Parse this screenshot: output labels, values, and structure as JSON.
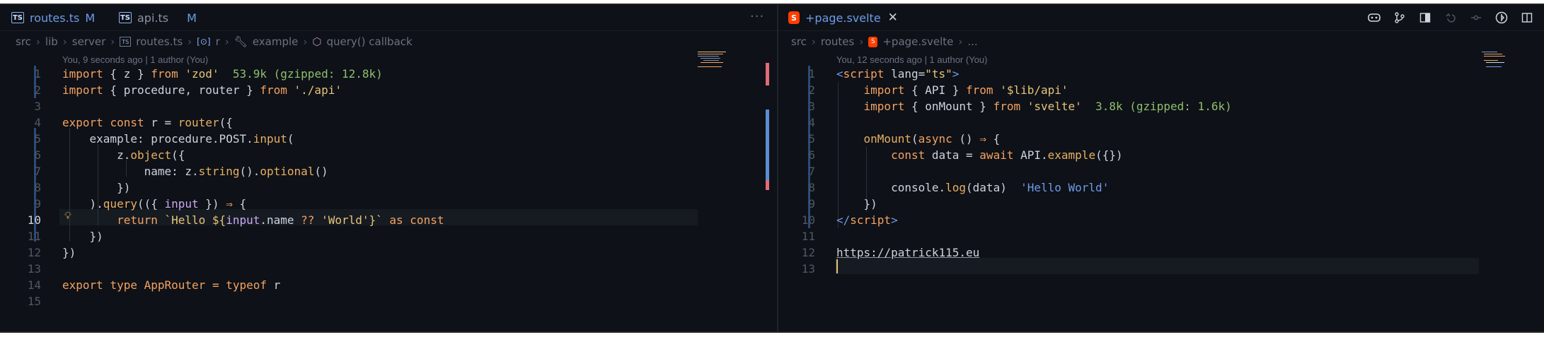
{
  "left": {
    "tabs": [
      {
        "label": "routes.ts",
        "modified": "M",
        "logo": "TS"
      },
      {
        "label": "api.ts",
        "modified": "M",
        "logo": "TS"
      }
    ],
    "ellipsis": "···",
    "breadcrumb": [
      "src",
      "lib",
      "server",
      "routes.ts",
      "r",
      "example",
      "query() callback"
    ],
    "breadcrumb_icons": [
      "ts-file-icon",
      "object-icon",
      "wrench-icon",
      "cube-icon"
    ],
    "codelens": "You, 9 seconds ago | 1 author (You)",
    "lines": [
      {
        "n": "1"
      },
      {
        "n": "2"
      },
      {
        "n": "3"
      },
      {
        "n": "4"
      },
      {
        "n": "5"
      },
      {
        "n": "6"
      },
      {
        "n": "7"
      },
      {
        "n": "8"
      },
      {
        "n": "9"
      },
      {
        "n": "10"
      },
      {
        "n": "11"
      },
      {
        "n": "12"
      },
      {
        "n": "13"
      },
      {
        "n": "14"
      },
      {
        "n": "15"
      }
    ],
    "code": {
      "l1": {
        "t0": "import",
        "t1": " { z } ",
        "t2": "from",
        "t3": " ",
        "t4": "'zod'",
        "t5": "  53.9k (gzipped: 12.8k)"
      },
      "l2": {
        "t0": "import",
        "t1": " { procedure, router } ",
        "t2": "from",
        "t3": " ",
        "t4": "'./api'"
      },
      "l4": {
        "t0": "export",
        "t1": " ",
        "t2": "const",
        "t3": " r = ",
        "t4": "router",
        "t5": "({"
      },
      "l5": {
        "t0": "    example: procedure.POST.",
        "t1": "input",
        "t2": "("
      },
      "l6": {
        "t0": "        z.",
        "t1": "object",
        "t2": "({"
      },
      "l7": {
        "t0": "            name: z.",
        "t1": "string",
        "t2": "().",
        "t3": "optional",
        "t4": "()"
      },
      "l8": {
        "t0": "        })"
      },
      "l9": {
        "t0": "    ).",
        "t1": "query",
        "t2": "(({ ",
        "t3": "input",
        "t4": " }) ",
        "t5": "⇒",
        "t6": " {"
      },
      "l10": {
        "t0": "        ",
        "t1": "return",
        "t2": " `Hello ${",
        "t3": "input",
        "t4": ".name ",
        "t5": "??",
        "t6": " ",
        "t7": "'World'",
        "t8": "}`",
        "t9": " as ",
        "t10": "const"
      },
      "l11": {
        "t0": "    })"
      },
      "l12": {
        "t0": "})"
      },
      "l14": {
        "t0": "export",
        "t1": " ",
        "t2": "type",
        "t3": " ",
        "t4": "AppRouter",
        "t5": " = ",
        "t6": "typeof",
        "t7": " r"
      }
    }
  },
  "right": {
    "tab": {
      "label": "+page.svelte",
      "close": "✕",
      "logo": "S"
    },
    "breadcrumb": [
      "src",
      "routes",
      "+page.svelte",
      "..."
    ],
    "codelens": "You, 12 seconds ago | 1 author (You)",
    "lines": [
      {
        "n": "1"
      },
      {
        "n": "2"
      },
      {
        "n": "3"
      },
      {
        "n": "4"
      },
      {
        "n": "5"
      },
      {
        "n": "6"
      },
      {
        "n": "7"
      },
      {
        "n": "8"
      },
      {
        "n": "9"
      },
      {
        "n": "10"
      },
      {
        "n": "11"
      },
      {
        "n": "12"
      },
      {
        "n": "13"
      }
    ],
    "code": {
      "l1": {
        "t0": "<",
        "t1": "script",
        "t2": " lang=",
        "t3": "\"ts\"",
        "t4": ">"
      },
      "l2": {
        "t0": "    ",
        "t1": "import",
        "t2": " { API } ",
        "t3": "from",
        "t4": " ",
        "t5": "'$lib/api'"
      },
      "l3": {
        "t0": "    ",
        "t1": "import",
        "t2": " { onMount } ",
        "t3": "from",
        "t4": " ",
        "t5": "'svelte'",
        "t6": "  3.8k (gzipped: 1.6k)"
      },
      "l5": {
        "t0": "    ",
        "t1": "onMount",
        "t2": "(",
        "t3": "async",
        "t4": " () ",
        "t5": "⇒",
        "t6": " {"
      },
      "l6": {
        "t0": "        ",
        "t1": "const",
        "t2": " data = ",
        "t3": "await",
        "t4": " API.",
        "t5": "example",
        "t6": "({})"
      },
      "l8": {
        "t0": "        console.",
        "t1": "log",
        "t2": "(data)",
        "t3": "  'Hello World'"
      },
      "l9": {
        "t0": "    })"
      },
      "l10": {
        "t0": "</",
        "t1": "script",
        "t2": ">"
      },
      "l12": {
        "t0": "https://patrick115.eu"
      }
    },
    "toolbar_icons": [
      "copilot-icon",
      "source-control-icon",
      "open-preview-icon",
      "go-back-icon",
      "go-forward-icon",
      "toggle-icon",
      "split-editor-icon"
    ]
  },
  "colors": {
    "background": "#0e1117",
    "keyword": "#f4a261",
    "string": "#e6c47a",
    "size_hint": "#8fbf6f",
    "inlay": "#6d9be8",
    "modified": "#6d9be8",
    "svelte": "#ff3e00"
  }
}
